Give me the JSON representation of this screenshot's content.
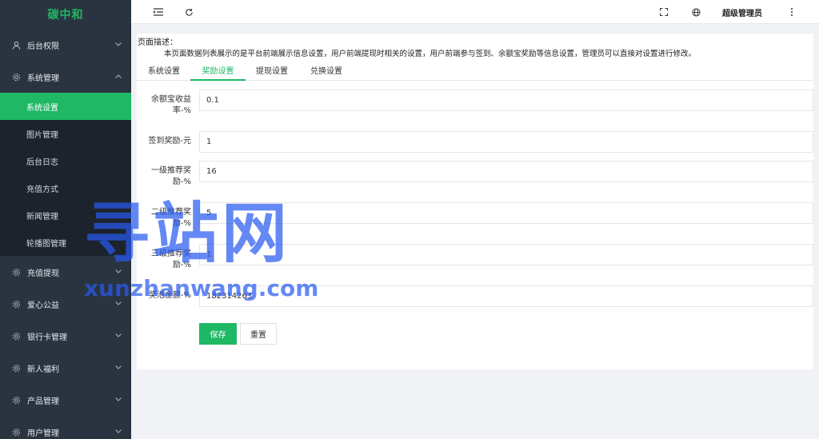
{
  "app": {
    "logo": "碳中和"
  },
  "sidebar": {
    "items": [
      {
        "label": "后台权限",
        "icon": "user-icon",
        "chevron": "﹀"
      },
      {
        "label": "系统管理",
        "icon": "gear-icon",
        "chevron": "︿"
      },
      {
        "label": "充值提现",
        "icon": "gear-icon",
        "chevron": "﹀"
      },
      {
        "label": "爱心公益",
        "icon": "gear-icon",
        "chevron": "﹀"
      },
      {
        "label": "银行卡管理",
        "icon": "gear-icon",
        "chevron": "﹀"
      },
      {
        "label": "新人福利",
        "icon": "gear-icon",
        "chevron": "﹀"
      },
      {
        "label": "产品管理",
        "icon": "gear-icon",
        "chevron": "﹀"
      },
      {
        "label": "用户管理",
        "icon": "gear-icon",
        "chevron": "﹀"
      }
    ],
    "submenu": [
      {
        "label": "系统设置"
      },
      {
        "label": "图片管理"
      },
      {
        "label": "后台日志"
      },
      {
        "label": "充值方式"
      },
      {
        "label": "新闻管理"
      },
      {
        "label": "轮播图管理"
      }
    ]
  },
  "topbar": {
    "user": "超级管理员"
  },
  "page": {
    "desc_title": "页面描述：",
    "desc_text": "本页面数据列表展示的是平台前端展示信息设置，用户前端提现时相关的设置，用户前端参与签到、余额宝奖励等信息设置，管理员可以直接对设置进行修改。",
    "tabs": [
      {
        "label": "系统设置"
      },
      {
        "label": "奖励设置"
      },
      {
        "label": "提现设置"
      },
      {
        "label": "兑换设置"
      }
    ],
    "active_tab": "奖励设置",
    "fields": [
      {
        "label_line1": "余额宝收益",
        "label_line2": "率-%",
        "value": "0.1"
      },
      {
        "label_line1": "签到奖励-元",
        "label_line2": "",
        "value": "1"
      },
      {
        "label_line1": "一级推荐奖",
        "label_line2": "励-%",
        "value": "16"
      },
      {
        "label_line1": "二级推荐奖",
        "label_line2": "励-%",
        "value": "5"
      },
      {
        "label_line1": "三级推荐奖",
        "label_line2": "励-%",
        "value": "1"
      },
      {
        "label_line1": "奖池金额-%",
        "label_line2": "",
        "value": "182314263"
      }
    ],
    "buttons": {
      "save": "保存",
      "reset": "重置"
    }
  },
  "watermark": {
    "big": "寻站网",
    "small": "xunzhanwang.com"
  },
  "colors": {
    "accent": "#1fb865",
    "sidebar_bg": "#2a3440",
    "submenu_bg": "#1c232c"
  }
}
